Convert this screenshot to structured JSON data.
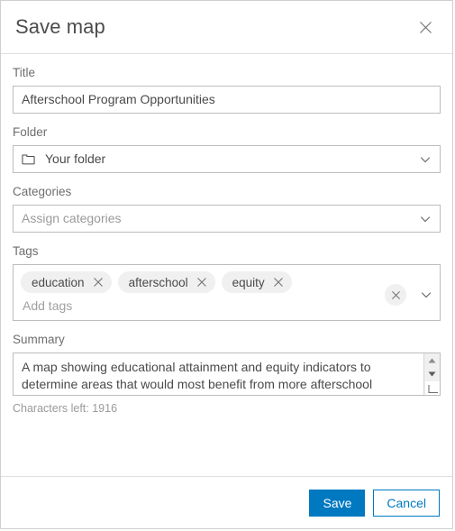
{
  "dialog": {
    "title": "Save map",
    "close_icon": "close-icon"
  },
  "form": {
    "title_field": {
      "label": "Title",
      "value": "Afterschool Program Opportunities"
    },
    "folder_field": {
      "label": "Folder",
      "value": "Your folder",
      "icon": "folder-icon",
      "chevron": "chevron-down-icon"
    },
    "categories_field": {
      "label": "Categories",
      "placeholder": "Assign categories",
      "chevron": "chevron-down-icon"
    },
    "tags_field": {
      "label": "Tags",
      "tags": [
        "education",
        "afterschool",
        "equity"
      ],
      "placeholder": "Add tags",
      "clear_icon": "close-icon",
      "chevron": "chevron-down-icon"
    },
    "summary_field": {
      "label": "Summary",
      "value": "A map showing educational attainment and equity indicators to determine areas that would most benefit from more afterschool programs.",
      "characters_left": "Characters left: 1916"
    }
  },
  "footer": {
    "save_label": "Save",
    "cancel_label": "Cancel"
  },
  "colors": {
    "accent": "#0079c1",
    "border": "#bdbdbd",
    "chip_bg": "#f0f0f0",
    "label": "#6e6e6e"
  }
}
